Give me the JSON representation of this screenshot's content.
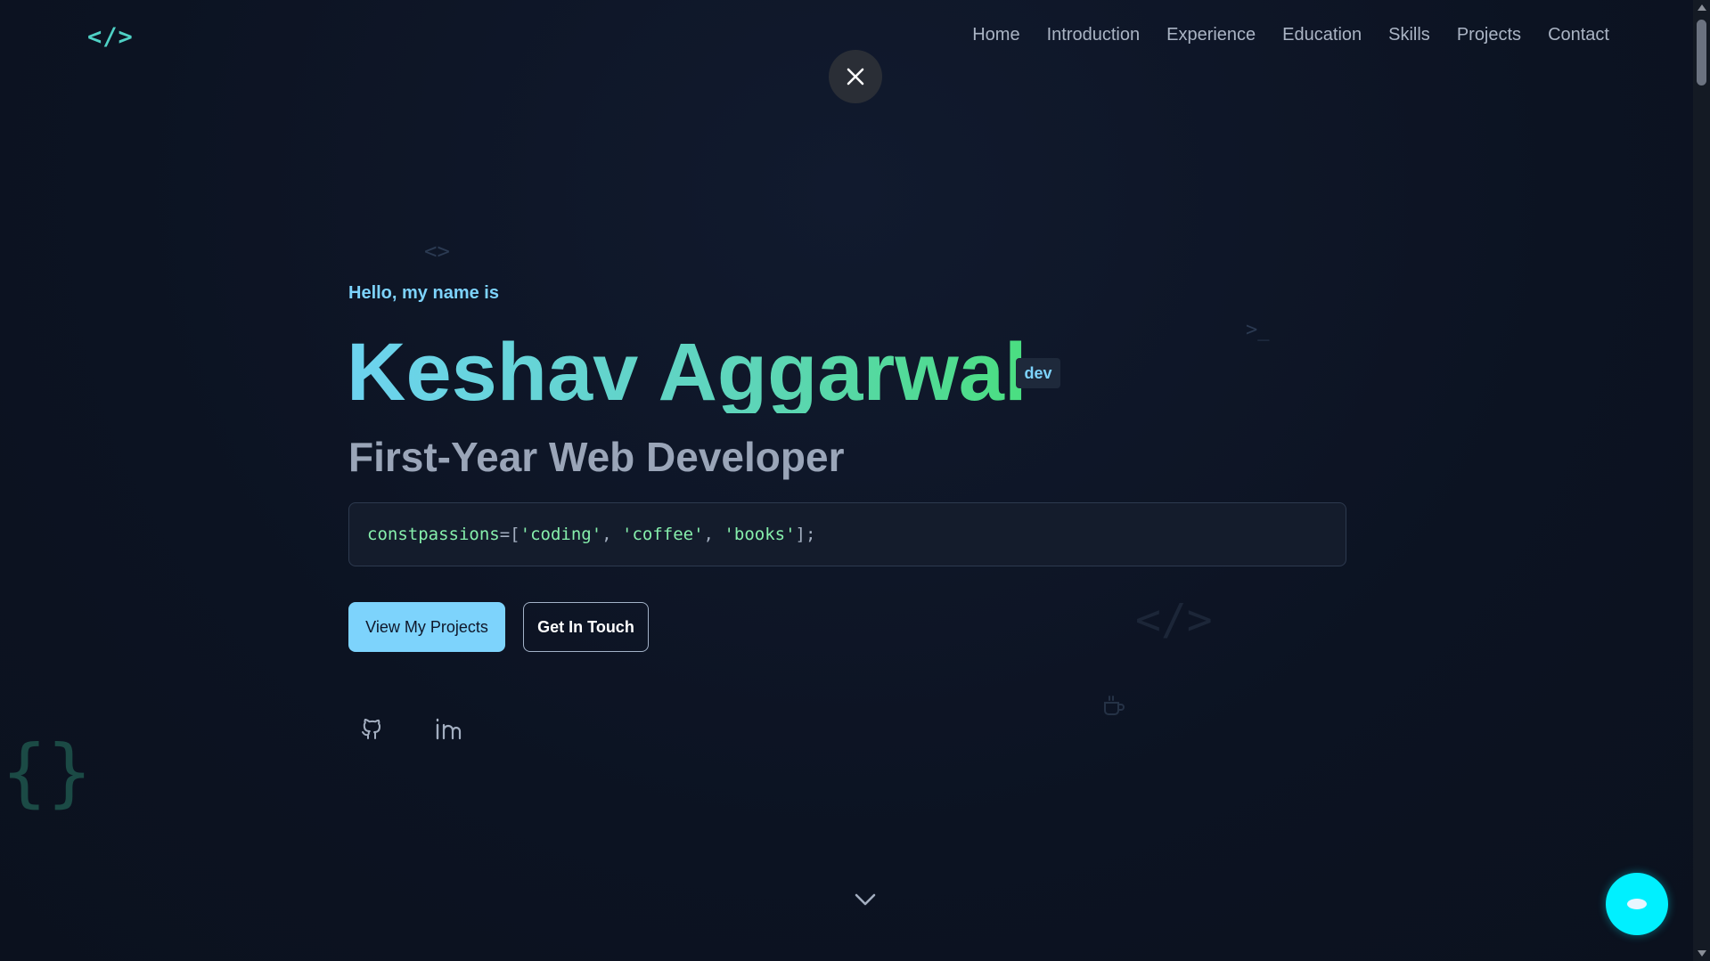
{
  "nav": {
    "logo": "</>",
    "links": [
      "Home",
      "Introduction",
      "Experience",
      "Education",
      "Skills",
      "Projects",
      "Contact"
    ]
  },
  "hero": {
    "greeting": "Hello, my name is",
    "name": "Keshav Aggarwal",
    "badge": "dev",
    "role": "First-Year Web Developer",
    "code": {
      "keyword": "const",
      "identifier": "passions",
      "operator": "=",
      "items": [
        "'coding'",
        "'coffee'",
        "'books'"
      ]
    },
    "primary_button": "View My Projects",
    "secondary_button": "Get In Touch"
  },
  "decorations": {
    "brackets": "<>",
    "prompt": ">_",
    "tag": "</>",
    "braces": "{}"
  },
  "icons": {
    "close": "close-icon",
    "github": "github-icon",
    "linkedin": "linkedin-icon",
    "scroll": "chevron-down-icon",
    "chat": "chat-icon",
    "cup": "coffee-cup-icon"
  },
  "colors": {
    "background": "#0c1322",
    "accent": "#7dd3fc",
    "logo": "#4fd1c5",
    "chat": "#00f0ff"
  }
}
